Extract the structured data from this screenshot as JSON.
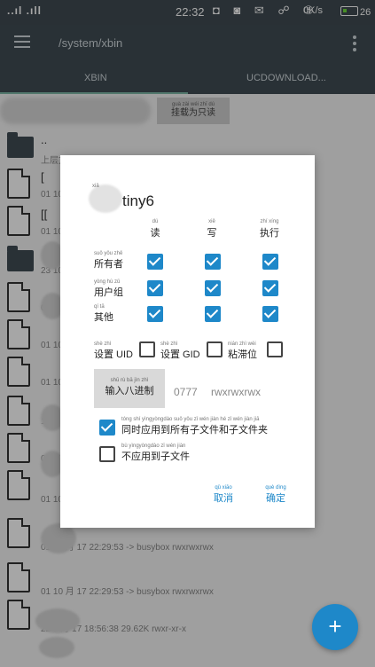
{
  "status_bar": {
    "signal": "..ıl .ıll",
    "time": "22:32",
    "notification_icons": "◘ ◙ ✉ ☍ ⑤",
    "net_speed": "0K/s",
    "battery_level": "26"
  },
  "app_bar": {
    "path": "/system/xbin"
  },
  "tabs": [
    {
      "label": "XBIN"
    },
    {
      "label": "UCDOWNLOAD..."
    }
  ],
  "toolbar": {
    "readonly_pinyin": "guà zài wéi zhī dú",
    "readonly_label": "挂载为只读"
  },
  "file_rows": [
    {
      "name": "..",
      "meta": "上层文件夹",
      "kind": "folder"
    },
    {
      "name": "[",
      "meta": "01 10",
      "kind": "file"
    },
    {
      "name": "[[",
      "meta": "01 10",
      "kind": "file"
    },
    {
      "name": "",
      "meta": "23 10",
      "kind": "folder"
    },
    {
      "name": "",
      "meta": "01 10",
      "kind": "file"
    },
    {
      "name": "",
      "meta": "01 10",
      "kind": "file"
    },
    {
      "name": "",
      "meta": "01 10",
      "kind": "file"
    },
    {
      "name": "",
      "meta": "14",
      "kind": "file"
    },
    {
      "name": "",
      "meta": "01 10",
      "kind": "file"
    },
    {
      "name": "",
      "meta": "01 10 月 17 22:29:53 -> busybox rwxrwxrwx",
      "kind": "file"
    },
    {
      "name": "",
      "meta": "01 10 月 17 22:29:53 -> busybox rwxrwxrwx",
      "kind": "file"
    },
    {
      "name": "",
      "meta": "01 10 月 17 22:29:53 -> busybox rwxrwxrwx",
      "kind": "file"
    },
    {
      "name": "",
      "meta": "22 5 月 17 18:56:38 29.62K rwxr-xr-x",
      "kind": "file"
    }
  ],
  "dialog": {
    "title": "tiny6",
    "title_pinyin": "xiǎ",
    "columns": [
      {
        "pinyin": "dú",
        "label": "读"
      },
      {
        "pinyin": "xiě",
        "label": "写"
      },
      {
        "pinyin": "zhí xíng",
        "label": "执行"
      }
    ],
    "rows": [
      {
        "pinyin": "suǒ yǒu zhě",
        "label": "所有者",
        "checks": [
          true,
          true,
          true
        ]
      },
      {
        "pinyin": "yòng hù zǔ",
        "label": "用户组",
        "checks": [
          true,
          true,
          true
        ]
      },
      {
        "pinyin": "qí tā",
        "label": "其他",
        "checks": [
          true,
          true,
          true
        ]
      }
    ],
    "special": [
      {
        "pinyin": "shè zhì",
        "label": "设置 UID",
        "checked": false
      },
      {
        "pinyin": "shè zhì",
        "label": "设置 GID",
        "checked": false
      },
      {
        "pinyin": "nián zhì wèi",
        "label": "粘滞位",
        "checked": false
      }
    ],
    "octal_button_pinyin": "shū rù bā jìn zhì",
    "octal_button": "输入八进制",
    "octal_value": "0777",
    "permission_string": "rwxrwxrwx",
    "apply_recursive_pinyin": "tóng shí yìngyòngdào suǒ yǒu zǐ wén jiàn hé zǐ wén jiàn jiā",
    "apply_recursive": "同时应用到所有子文件和子文件夹",
    "apply_recursive_checked": true,
    "no_apply_children_pinyin": "bù yìngyòngdào zǐ wén jiàn",
    "no_apply_children": "不应用到子文件",
    "no_apply_children_checked": false,
    "cancel_pinyin": "qǔ xiāo",
    "cancel": "取消",
    "ok_pinyin": "què dìng",
    "ok": "确定"
  },
  "fab": {
    "label": "+"
  },
  "colors": {
    "appbar": "#404c54",
    "accent": "#1e88c9",
    "tab_indicator": "#7fb9a8"
  }
}
